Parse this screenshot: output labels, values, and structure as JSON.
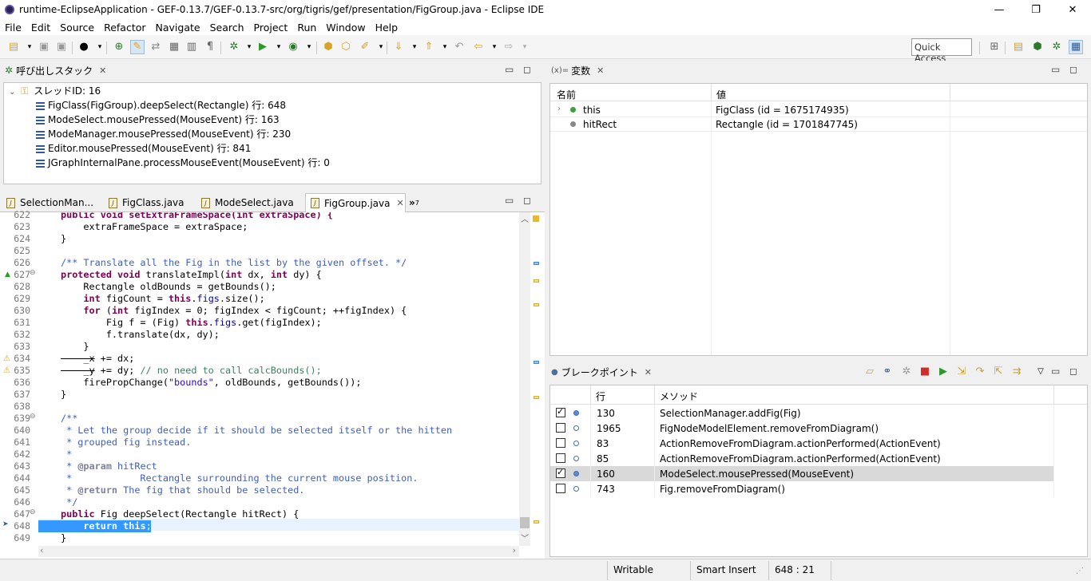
{
  "window": {
    "title": "runtime-EclipseApplication - GEF-0.13.7/GEF-0.13.7-src/org/tigris/gef/presentation/FigGroup.java - Eclipse IDE",
    "minimize": "—",
    "restore": "❐",
    "close": "✕"
  },
  "menu": [
    "File",
    "Edit",
    "Source",
    "Refactor",
    "Navigate",
    "Search",
    "Project",
    "Run",
    "Window",
    "Help"
  ],
  "quick_access": "Quick Access",
  "callstack": {
    "title": "呼び出しスタック",
    "thread": "スレッドID: 16",
    "frames": [
      "FigClass(FigGroup).deepSelect(Rectangle) 行: 648",
      "ModeSelect.mousePressed(MouseEvent) 行: 163",
      "ModeManager.mousePressed(MouseEvent) 行: 230",
      "Editor.mousePressed(MouseEvent) 行: 841",
      "JGraphInternalPane.processMouseEvent(MouseEvent) 行: 0"
    ]
  },
  "editor_tabs": [
    "SelectionMan...",
    "FigClass.java",
    "ModeSelect.java",
    "FigGroup.java"
  ],
  "editor_overflow": "»",
  "editor_overflow_count": "7",
  "line_numbers": [
    "622",
    "623",
    "624",
    "625",
    "626",
    "627",
    "628",
    "629",
    "630",
    "631",
    "632",
    "633",
    "634",
    "635",
    "636",
    "637",
    "638",
    "639",
    "640",
    "641",
    "642",
    "643",
    "644",
    "645",
    "646",
    "647",
    "648",
    "649"
  ],
  "code": {
    "l622a": "public void setExtraFrameSpace(int extraSpace) {",
    "l623a": "    extraFrameSpace = extraSpace;",
    "l624": "}",
    "l626": "/** Translate all the Fig in the list by the given offset. */",
    "l627a": "protected void",
    "l627b": " translateImpl(",
    "l627c": "int",
    "l627d": " dx, ",
    "l627e": "int",
    "l627f": " dy) {",
    "l628": "    Rectangle oldBounds = getBounds();",
    "l629a": "    int",
    "l629b": " figCount = ",
    "l629c": "this",
    "l629d": ".",
    "l629e": "figs",
    "l629f": ".size();",
    "l630a": "    for",
    "l630b": " (",
    "l630c": "int",
    "l630d": " figIndex = 0; figIndex < figCount; ++figIndex) {",
    "l631a": "        Fig f = (Fig) ",
    "l631b": "this",
    "l631c": ".",
    "l631d": "figs",
    "l631e": ".get(figIndex);",
    "l632": "        f.translate(dx, dy);",
    "l633": "    }",
    "l634a": "    _x",
    "l634b": " += dx;",
    "l635a": "    _y",
    "l635b": " += dy; ",
    "l635c": "// no need to call calcBounds();",
    "l636a": "    firePropChange(",
    "l636b": "\"bounds\"",
    "l636c": ", oldBounds, getBounds());",
    "l637": "}",
    "l639": "/**",
    "l640": " * Let the group decide if it should be selected itself or the hitten",
    "l641": " * grouped fig instead.",
    "l642": " *",
    "l643a": " * ",
    "l643b": "@param",
    "l643c": " hitRect",
    "l644": " *            Rectangle surrounding the current mouse position.",
    "l645a": " * ",
    "l645b": "@return",
    "l645c": " The fig that should be selected.",
    "l646": " */",
    "l647a": "public",
    "l647b": " Fig deepSelect(Rectangle hitRect) {",
    "l648a": "    ",
    "l648b": "return",
    "l648c": " ",
    "l648d": "this",
    "l648e": ";",
    "l649": "}"
  },
  "variables": {
    "title": "変数",
    "title_prefix": "(x)=",
    "col_name": "名前",
    "col_value": "値",
    "rows": [
      {
        "name": "this",
        "value": "FigClass (id = 1675174935)"
      },
      {
        "name": "hitRect",
        "value": "Rectangle (id = 1701847745)"
      }
    ]
  },
  "breakpoints": {
    "title": "ブレークポイント",
    "col_line": "行",
    "col_method": "メソッド",
    "rows": [
      {
        "checked": true,
        "line": "130",
        "method": "SelectionManager.addFig(Fig)"
      },
      {
        "checked": false,
        "line": "1965",
        "method": "FigNodeModelElement.removeFromDiagram()"
      },
      {
        "checked": false,
        "line": "83",
        "method": "ActionRemoveFromDiagram.actionPerformed(ActionEvent)"
      },
      {
        "checked": false,
        "line": "85",
        "method": "ActionRemoveFromDiagram.actionPerformed(ActionEvent)"
      },
      {
        "checked": true,
        "line": "160",
        "method": "ModeSelect.mousePressed(MouseEvent)"
      },
      {
        "checked": false,
        "line": "743",
        "method": "Fig.removeFromDiagram()"
      }
    ]
  },
  "status": {
    "writable": "Writable",
    "insert": "Smart Insert",
    "position": "648 : 21"
  },
  "colors": {
    "keyword": "#7f0055",
    "comment": "#3f5fbf",
    "field": "#0000c0",
    "string": "#2a00ff",
    "selection": "#3399ff"
  }
}
